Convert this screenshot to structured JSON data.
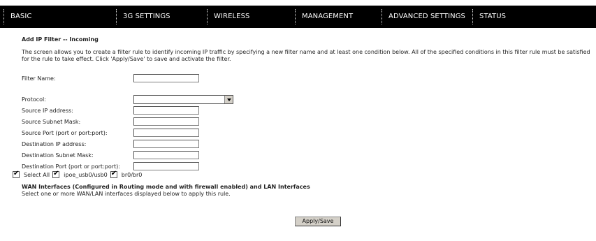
{
  "nav": {
    "tabs": [
      "BASIC",
      "3G SETTINGS",
      "WIRELESS",
      "MANAGEMENT",
      "ADVANCED SETTINGS",
      "STATUS"
    ]
  },
  "form": {
    "title": "Add IP Filter -- Incoming",
    "description_line1": "The screen allows you to create a filter rule to identify incoming IP traffic by specifying a new filter name and at least one condition below. All of the specified conditions in this filter rule must be satisfied",
    "description_line2": "for the rule to take effect. Click 'Apply/Save' to save and activate the filter.",
    "fields": {
      "filter_name": {
        "label": "Filter Name:",
        "value": ""
      },
      "protocol": {
        "label": "Protocol:",
        "value": ""
      },
      "source_ip": {
        "label": "Source IP address:",
        "value": ""
      },
      "source_subnet": {
        "label": "Source Subnet Mask:",
        "value": ""
      },
      "source_port": {
        "label": "Source Port (port or port:port):",
        "value": ""
      },
      "dest_ip": {
        "label": "Destination IP address:",
        "value": ""
      },
      "dest_subnet": {
        "label": "Destination Subnet Mask:",
        "value": ""
      },
      "dest_port": {
        "label": "Destination Port (port or port:port):",
        "value": ""
      }
    },
    "wan": {
      "heading": "WAN Interfaces (Configured in Routing mode and with firewall enabled) and LAN Interfaces",
      "subtext": "Select one or more WAN/LAN interfaces displayed below to apply this rule.",
      "select_all": "Select All",
      "interfaces": [
        "ipoe_usb0/usb0",
        "br0/br0"
      ]
    },
    "apply_label": "Apply/Save"
  }
}
